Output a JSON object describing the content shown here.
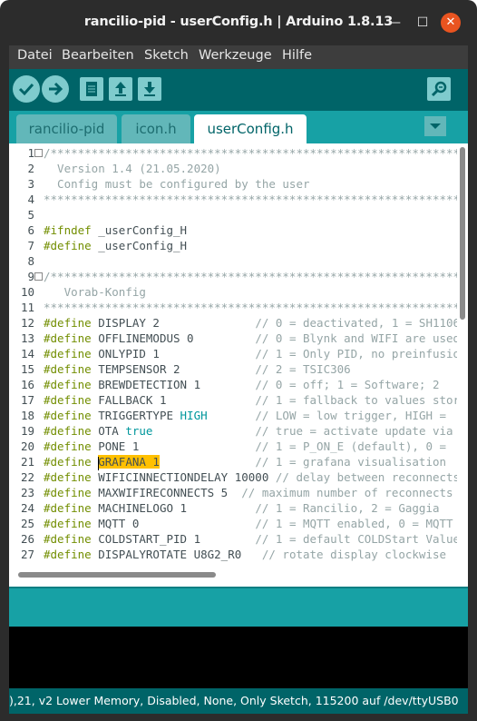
{
  "window": {
    "title": "rancilio-pid - userConfig.h | Arduino 1.8.13",
    "minimize_glyph": "—",
    "maximize_glyph": "☐",
    "close_glyph": "✕"
  },
  "menu": {
    "items": [
      "Datei",
      "Bearbeiten",
      "Sketch",
      "Werkzeuge",
      "Hilfe"
    ]
  },
  "toolbar": {
    "buttons": [
      "verify-icon",
      "upload-icon",
      "new-icon",
      "open-icon",
      "save-icon",
      "serial-monitor-icon"
    ]
  },
  "tabs": {
    "items": [
      "rancilio-pid",
      "icon.h",
      "userConfig.h"
    ],
    "active": "userConfig.h"
  },
  "editor": {
    "line_numbers": [
      "1",
      "2",
      "3",
      "4",
      "5",
      "6",
      "7",
      "8",
      "9",
      "10",
      "11",
      "12",
      "13",
      "14",
      "15",
      "16",
      "17",
      "18",
      "19",
      "20",
      "21",
      "22",
      "23",
      "24",
      "25",
      "26",
      "27"
    ],
    "lines": [
      "/*********************************************************************",
      "  Version 1.4 (21.05.2020)",
      "  Config must be configured by the user",
      "******************************************************************/",
      "",
      "#ifndef _userConfig_H",
      "#define _userConfig_H",
      "",
      "/*********************************************************************",
      "   Vorab-Konfig",
      "******************************************************************/",
      "#define DISPLAY 2              // 0 = deactivated, 1 = SH1106",
      "#define OFFLINEMODUS 0         // 0 = Blynk and WIFI are used",
      "#define ONLYPID 1              // 1 = Only PID, no preinfusion",
      "#define TEMPSENSOR 2           // 2 = TSIC306",
      "#define BREWDETECTION 1        // 0 = off; 1 = Software; 2",
      "#define FALLBACK 1             // 1 = fallback to values stored",
      "#define TRIGGERTYPE HIGH       // LOW = low trigger, HIGH =",
      "#define OTA true               // true = activate update via",
      "#define PONE 1                 // 1 = P_ON_E (default), 0 =",
      "#define GRAFANA 1              // 1 = grafana visualisation",
      "#define WIFICINNECTIONDELAY 10000 // delay between reconnects",
      "#define MAXWIFIRECONNECTS 5  // maximum number of reconnects",
      "#define MACHINELOGO 1          // 1 = Rancilio, 2 = Gaggia",
      "#define MQTT 0                 // 1 = MQTT enabled, 0 = MQTT",
      "#define COLDSTART_PID 1        // 1 = default COLDStart Values",
      "#define DISPALYROTATE U8G2_R0   // rotate display clockwise"
    ]
  },
  "footer": {
    "status": "),21, v2 Lower Memory, Disabled, None, Only Sketch, 115200 auf /dev/ttyUSB0"
  },
  "colors": {
    "toolbar": "#006468",
    "tabs": "#17a1a5",
    "highlight": "#ffc000",
    "close": "#e95420"
  }
}
